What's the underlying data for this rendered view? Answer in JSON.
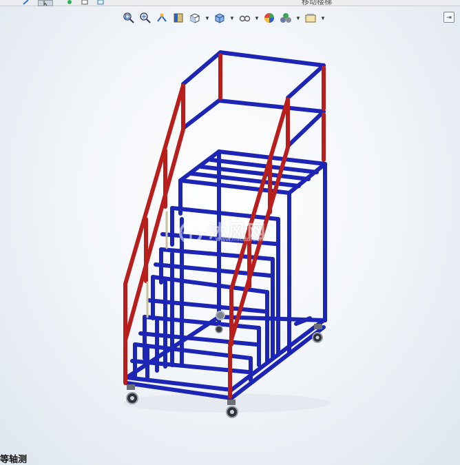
{
  "window": {
    "title": "移动楼梯",
    "view_name": "等轴测"
  },
  "headsup_toolbar": [
    {
      "name": "zoom-to-fit-icon"
    },
    {
      "name": "zoom-to-area-icon"
    },
    {
      "name": "previous-view-icon"
    },
    {
      "name": "section-view-icon"
    },
    {
      "name": "view-orientation-icon",
      "dropdown": true
    },
    {
      "name": "display-style-icon",
      "dropdown": true
    },
    {
      "name": "hide-show-items-icon",
      "dropdown": true
    },
    {
      "name": "edit-appearance-icon"
    },
    {
      "name": "apply-scene-icon",
      "dropdown": true
    },
    {
      "name": "view-settings-icon",
      "dropdown": true
    }
  ],
  "watermark": {
    "text": "沐风网",
    "url": "www.mfcad.com"
  },
  "colors": {
    "frame_blue": "#1c25b4",
    "rail_red": "#b81f1c",
    "background_light": "#ffffff",
    "background_edge": "#dfe6ee"
  }
}
